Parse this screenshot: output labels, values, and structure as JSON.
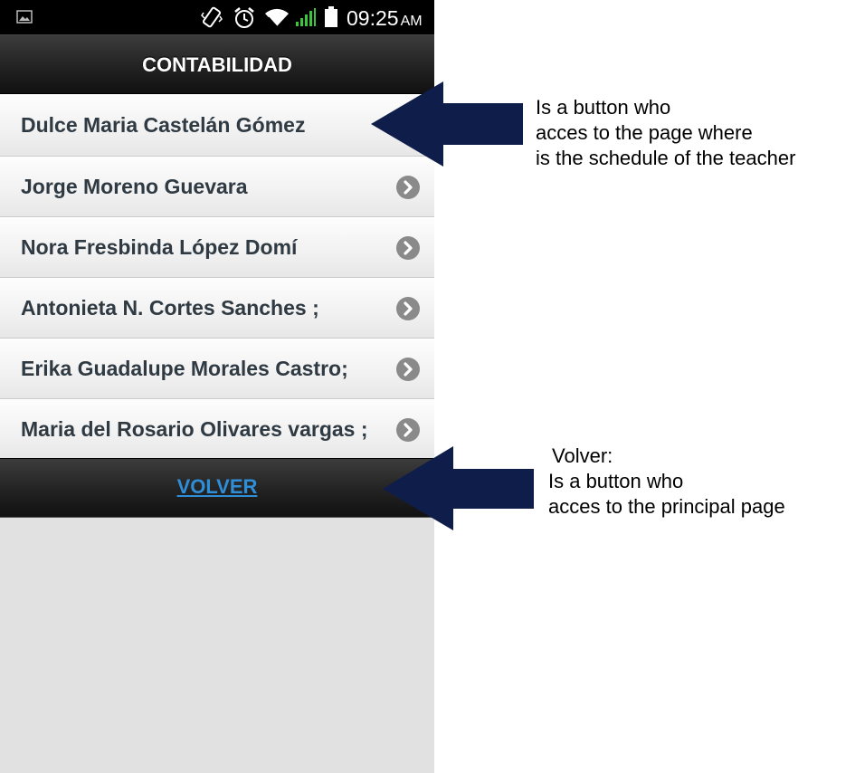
{
  "status_bar": {
    "time": "09:25",
    "ampm": "AM",
    "icons": [
      "gallery-icon",
      "vibrate-icon",
      "alarm-icon",
      "wifi-icon",
      "signal-icon",
      "battery-icon"
    ]
  },
  "header": {
    "title": "CONTABILIDAD"
  },
  "teachers": [
    {
      "name": "Dulce Maria Castelán Gómez",
      "has_arrow": false
    },
    {
      "name": "Jorge Moreno Guevara",
      "has_arrow": true
    },
    {
      "name": "Nora Fresbinda López Domí",
      "has_arrow": true
    },
    {
      "name": "Antonieta N. Cortes Sanches ;",
      "has_arrow": true
    },
    {
      "name": "Erika Guadalupe Morales Castro;",
      "has_arrow": true
    },
    {
      "name": "Maria del Rosario Olivares vargas ;",
      "has_arrow": true
    }
  ],
  "footer": {
    "volver_label": "VOLVER"
  },
  "annotations": {
    "list_note": {
      "lines": [
        "Is a button who",
        "acces to the page where",
        "is the schedule of the teacher"
      ]
    },
    "volver_note": {
      "lines": [
        "Volver:",
        "Is a button who",
        "acces to the principal page"
      ]
    },
    "arrow_color": "#0e1d4a"
  },
  "colors": {
    "link": "#2e8ed8",
    "item_text": "#2f3a43",
    "arrow_circle": "#8a8a8a"
  }
}
